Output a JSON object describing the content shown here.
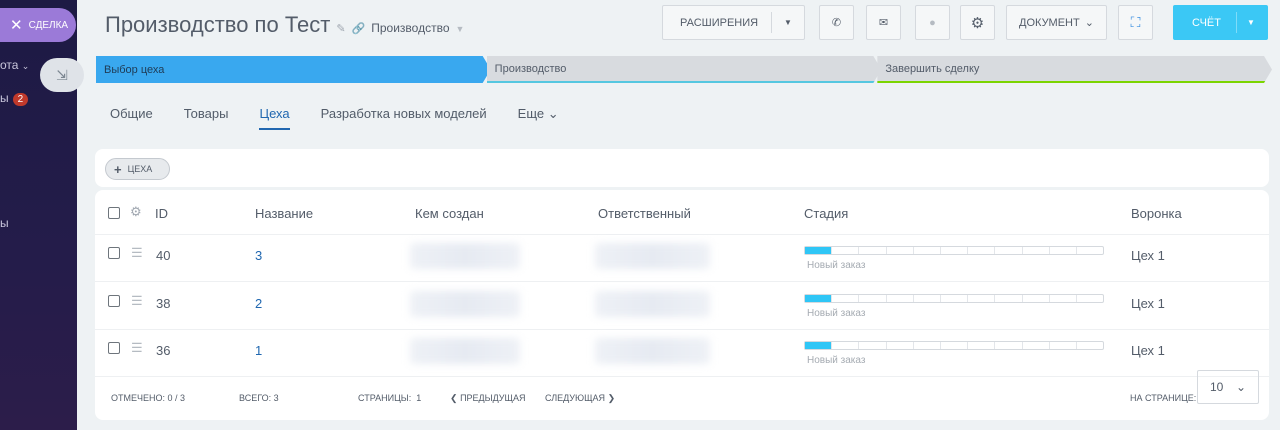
{
  "sidebar": {
    "deal_label": "СДЕЛКА",
    "partial_1": "ота",
    "partial_2": "ы",
    "badge": "2",
    "partial_3": "ы"
  },
  "header": {
    "title": "Производство по Тест",
    "funnel": "Производство"
  },
  "toolbar": {
    "extensions": "РАСШИРЕНИЯ",
    "document": "ДОКУМЕНТ",
    "invoice": "СЧЁТ"
  },
  "stages": [
    {
      "label": "Выбор цеха"
    },
    {
      "label": "Производство"
    },
    {
      "label": "Завершить сделку"
    }
  ],
  "tabs": [
    {
      "label": "Общие"
    },
    {
      "label": "Товары"
    },
    {
      "label": "Цеха",
      "active": true
    },
    {
      "label": "Разработка новых моделей"
    },
    {
      "label": "Еще"
    }
  ],
  "add_button": "ЦЕХА",
  "table": {
    "columns": [
      "ID",
      "Название",
      "Кем создан",
      "Ответственный",
      "Стадия",
      "Воронка"
    ],
    "rows": [
      {
        "id": "40",
        "name": "3",
        "stage": "Новый заказ",
        "stage_progress": "1/11",
        "funnel": "Цех 1"
      },
      {
        "id": "38",
        "name": "2",
        "stage": "Новый заказ",
        "stage_progress": "1/11",
        "funnel": "Цех 1"
      },
      {
        "id": "36",
        "name": "1",
        "stage": "Новый заказ",
        "stage_progress": "1/11",
        "funnel": "Цех 1"
      }
    ]
  },
  "footer": {
    "selected": "ОТМЕЧЕНО: 0 / 3",
    "total": "ВСЕГО: 3",
    "pages": "СТРАНИЦЫ:",
    "page": "1",
    "prev": "ПРЕДЫДУЩАЯ",
    "next": "СЛЕДУЮЩАЯ",
    "per_page_label": "НА СТРАНИЦЕ:",
    "per_page": "10"
  },
  "colors": {
    "accent": "#2067b0",
    "stage_active": "#39a8ef",
    "invoice": "#3bc8f5",
    "sidebar_pill": "#9b7ad8"
  }
}
